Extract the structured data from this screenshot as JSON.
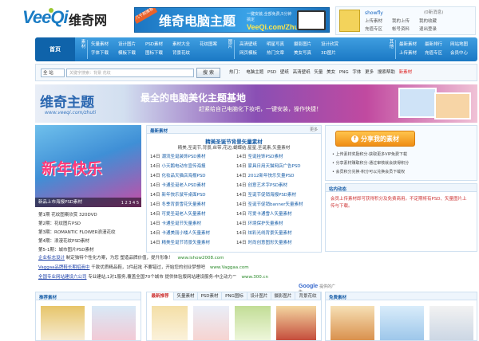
{
  "header": {
    "logo_latin": "VeeQi",
    "logo_cn": "维奇网",
    "banner": {
      "ribbon": "几千款推荐",
      "title": "维奇电脑主题",
      "tag": "一键安装,全部免费,5分钟搞定",
      "url": "VeeQi.com/ZhuTi"
    },
    "user": {
      "name": "showfly",
      "mailbox": "(0新消息)",
      "links": [
        "上传素材",
        "我的上传",
        "我的收藏",
        "充值专区",
        "帐号资料",
        "退出登录"
      ]
    }
  },
  "nav": {
    "home": "首页",
    "groups": [
      {
        "label": "素材",
        "links": [
          "矢量素材",
          "设计图片",
          "PSD素材",
          "素材大全",
          "花纹图案",
          "字体下载",
          "模板下载",
          "图标下载",
          "背景花纹"
        ]
      },
      {
        "label": "图片",
        "links": [
          "高清壁纸",
          "明星写真",
          "摄影图片",
          "设计欣赏",
          "网页模板",
          "热门文章",
          "美女写真",
          "3D图片"
        ]
      },
      {
        "label": "其他",
        "links": [
          "最新素材",
          "最新排行",
          "网站地图",
          "上传素材",
          "充值专区",
          "会员中心"
        ]
      }
    ]
  },
  "search": {
    "scope": "全 站",
    "placeholder": "关键字搜索：背景 花纹",
    "button": "搜 索",
    "hot_label": "热门：",
    "hot": [
      "电脑主题",
      "PSD",
      "壁纸",
      "高清壁纸",
      "矢量",
      "美女",
      "PNG",
      "字体",
      "更多"
    ],
    "extra": "搜索帮助",
    "extra_red": "新素材"
  },
  "promo": {
    "title": "维奇主题",
    "url": "www.veeqi.com/zhuti",
    "slogan": "最全的电脑美化主题基地",
    "sub": "赶紧给自己电脑化下妆吧，一键安装，操作快捷！"
  },
  "slider": {
    "title": "新年快乐",
    "caption": "新品上市海报PSD素材",
    "pager": "1 2 3 4 5"
  },
  "left_list": [
    "第1期 花纹图案欣赏  320DVD",
    "第2期：花纹图片PSD",
    "第3期：ROMANTIC FLOWER浪漫花纹",
    "第4期：浪漫花纹PSD素材",
    "第5-1期：城市图片PSD素材"
  ],
  "latest": {
    "title": "最新素材",
    "more": "更多",
    "headline": "精美圣诞节背景矢量素材",
    "subline": "精美,圣诞节,背景,丝带,花边,蝴蝶结,星星,圣诞素,矢量素材",
    "items": [
      {
        "d": "14日",
        "t": "潮流圣诞装饰PSD素材"
      },
      {
        "d": "14日",
        "t": "圣诞挂饰PSD素材"
      },
      {
        "d": "14日",
        "t": "小天鹅电动车宣传海报"
      },
      {
        "d": "14日",
        "t": "家具日用天猫网店广告PSD"
      },
      {
        "d": "14日",
        "t": "化妆品天猫店海报PSD"
      },
      {
        "d": "14日",
        "t": "2012新年快乐矢量PSD"
      },
      {
        "d": "14日",
        "t": "卡通圣诞老人PSD素材"
      },
      {
        "d": "14日",
        "t": "创意艺术字PSD素材"
      },
      {
        "d": "14日",
        "t": "新年快乐鼠年桌面PSD"
      },
      {
        "d": "14日",
        "t": "圣诞节促销海报PSD素材"
      },
      {
        "d": "14日",
        "t": "冬季背景雪花矢量素材"
      },
      {
        "d": "14日",
        "t": "圣诞节促销banner矢量素材"
      },
      {
        "d": "14日",
        "t": "可爱圣诞老人矢量素材"
      },
      {
        "d": "14日",
        "t": "可爱卡通雪人矢量素材"
      },
      {
        "d": "14日",
        "t": "卡通圣诞节矢量素材"
      },
      {
        "d": "14日",
        "t": "环境保护矢量素材"
      },
      {
        "d": "14日",
        "t": "卡通美丽小矮人矢量素材"
      },
      {
        "d": "14日",
        "t": "炫彩光线背景矢量素材"
      },
      {
        "d": "14日",
        "t": "精美圣诞节背景矢量素材"
      },
      {
        "d": "14日",
        "t": "时尚创意图形矢量素材"
      }
    ]
  },
  "share": {
    "button": "分享我的素材",
    "lines": [
      "• 上传素材奖励积分·获取更多VIP免费下载",
      "• 分享素材赚取积分·通过审核就会获得积分",
      "• 会员积分兑换·积分可以兑换会员下载权"
    ]
  },
  "site_news": {
    "title": "站内动态",
    "text": "会员上传素材即可获得积分及免费商用。不定期将有PSD、矢量图片上传与下载。"
  },
  "ads": [
    {
      "label": "企业标志设计",
      "text": "制定独特个性化方案，为您 塑造品牌价值，提升形象！",
      "url": "www.ishow2008.com"
    },
    {
      "label": "Vaggaa品牌鞋长期招商中",
      "text": "千款优质精品鞋，1件起批 不要错过，开始您的创业梦想吧",
      "url": "www.Vaggaa.com"
    },
    {
      "label": "全国专业网站建设六公司",
      "text": "专业建站,1对1服务,覆盖全国70个城市 提供体验版网站建设服务-中企动力™",
      "url": "www.300.cn"
    }
  ],
  "google": "Google",
  "google_sub": "提供的广告",
  "bottom": {
    "recommend": "推荐素材",
    "tabs": [
      "最新推荐",
      "矢量素材",
      "PSD素材",
      "PNG图标",
      "设计图片",
      "摄影图片",
      "背景花纹"
    ],
    "free": "免费素材"
  }
}
